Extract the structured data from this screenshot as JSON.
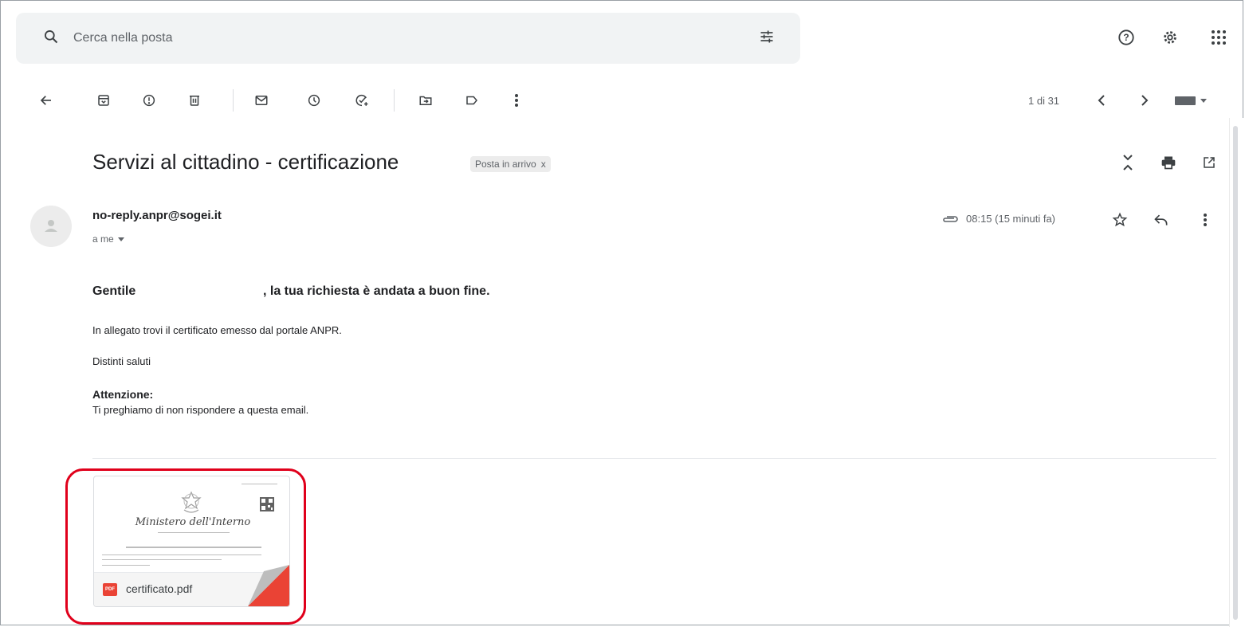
{
  "search": {
    "placeholder": "Cerca nella posta",
    "value": ""
  },
  "header_icons": [
    "help-icon",
    "settings-icon",
    "apps-icon"
  ],
  "toolbar": {
    "icons": [
      "back-arrow-icon",
      "archive-icon",
      "report-spam-icon",
      "delete-icon",
      "mark-unread-icon",
      "snooze-icon",
      "add-to-tasks-icon",
      "move-to-icon",
      "labels-icon",
      "more-vert-icon"
    ],
    "pagination": "1 di 31"
  },
  "email": {
    "subject": "Servizi al cittadino - certificazione",
    "label": "Posta in arrivo",
    "label_close": "x",
    "sender": "no-reply.anpr@sogei.it",
    "recipient": "a me",
    "time": "08:15 (15 minuti fa)",
    "greeting_start": "Gentile",
    "greeting_end": ", la tua richiesta è andata a buon fine.",
    "line1": "In allegato trovi il certificato emesso dal portale ANPR.",
    "line2": "Distinti saluti",
    "attention_title": "Attenzione:",
    "attention_text": "Ti preghiamo di non rispondere a questa email."
  },
  "attachment": {
    "filename": "certificato.pdf",
    "type_badge": "PDF",
    "preview_title": "Ministero dell'Interno"
  },
  "colors": {
    "highlight": "#e0001b",
    "pdf_red": "#ea4335",
    "search_bg": "#f1f3f4"
  }
}
